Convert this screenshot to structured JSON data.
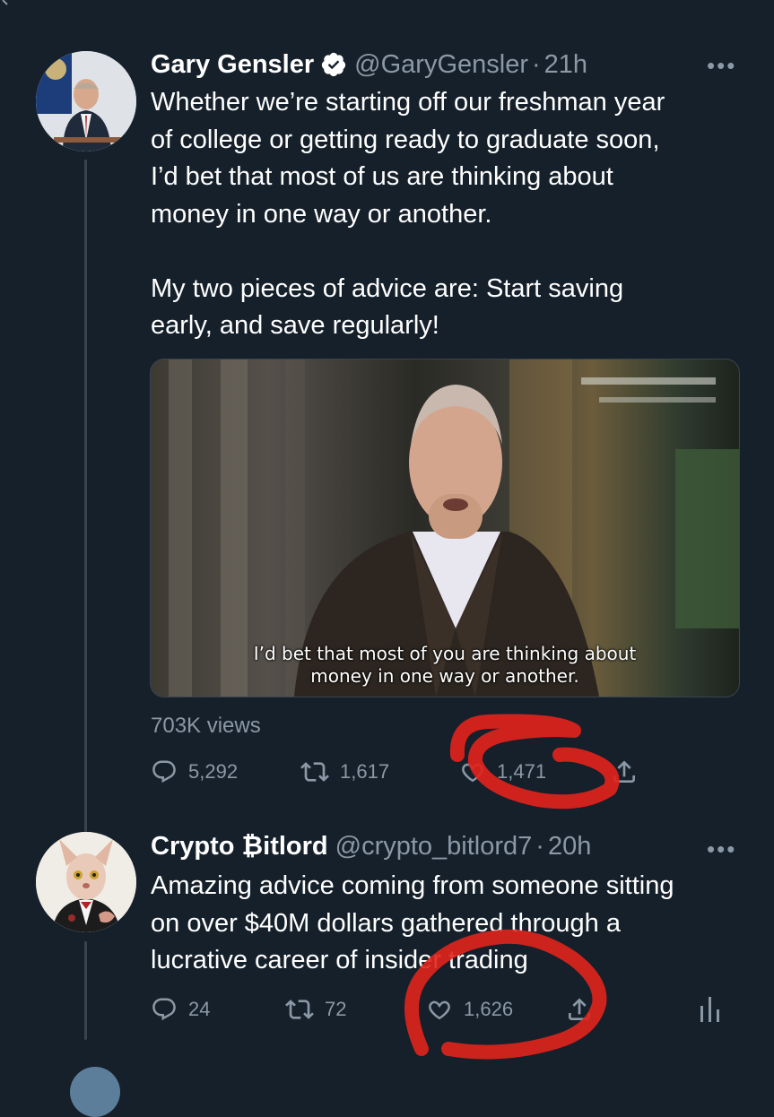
{
  "tweet1": {
    "name": "Gary Gensler",
    "verified": true,
    "handle": "@GaryGensler",
    "separator": "·",
    "time": "21h",
    "more": "•••",
    "text_lines": [
      "Whether we’re starting off our freshman year",
      "of college or getting ready to graduate soon,",
      "I’d bet that most of us are thinking about",
      "money in one way or another.",
      "",
      "My two pieces of advice are: Start saving",
      "early, and save regularly!"
    ],
    "video_caption_lines": [
      "I’d bet that most of you are thinking about",
      "money in one way or another."
    ],
    "views": "703K views",
    "replies": "5,292",
    "retweets": "1,617",
    "likes": "1,471"
  },
  "tweet2": {
    "name": "Crypto ₿itlord",
    "handle": "@crypto_bitlord7",
    "separator": "·",
    "time": "20h",
    "more": "•••",
    "text_lines": [
      "Amazing advice coming from someone sitting",
      "on over $40M dollars gathered through a",
      "lucrative career of insider trading"
    ],
    "replies": "24",
    "retweets": "72",
    "likes": "1,626"
  },
  "colors": {
    "background": "#15202b",
    "text": "#ffffff",
    "muted": "#8b98a5",
    "annotation": "#e0231c"
  },
  "icons": [
    "reply-icon",
    "retweet-icon",
    "like-icon",
    "share-icon",
    "analytics-icon",
    "verified-badge-icon",
    "more-icon"
  ]
}
